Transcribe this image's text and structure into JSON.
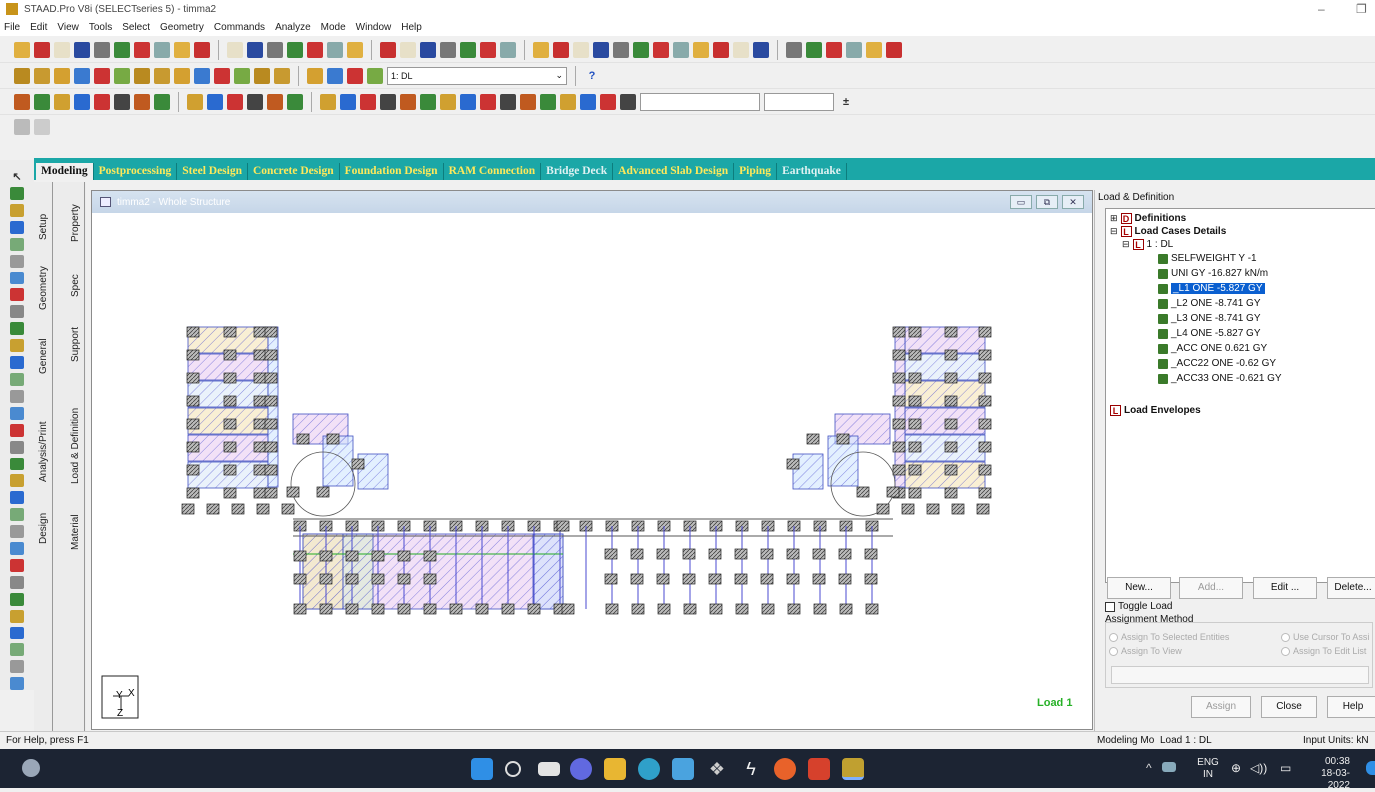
{
  "window": {
    "title": "STAAD.Pro V8i (SELECTseries 5) - timma2",
    "minimize": "–",
    "restore": "❐"
  },
  "menu": [
    "File",
    "Edit",
    "View",
    "Tools",
    "Select",
    "Geometry",
    "Commands",
    "Analyze",
    "Mode",
    "Window",
    "Help"
  ],
  "toolbar": {
    "load_combo": "1: DL",
    "help_icon": "?",
    "pm_icon": "±"
  },
  "ribbon_tabs": [
    {
      "label": "Modeling",
      "state": "active"
    },
    {
      "label": "Postprocessing",
      "state": "normal"
    },
    {
      "label": "Steel Design",
      "state": "normal"
    },
    {
      "label": "Concrete Design",
      "state": "normal"
    },
    {
      "label": "Foundation Design",
      "state": "normal"
    },
    {
      "label": "RAM Connection",
      "state": "normal"
    },
    {
      "label": "Bridge Deck",
      "state": "disabled"
    },
    {
      "label": "Advanced Slab Design",
      "state": "normal"
    },
    {
      "label": "Piping",
      "state": "normal"
    },
    {
      "label": "Earthquake",
      "state": "disabled"
    }
  ],
  "side_tabs_outer": [
    "Setup",
    "Geometry",
    "General",
    "Analysis/Print",
    "Design"
  ],
  "side_tabs_inner": [
    "Property",
    "Spec",
    "Support",
    "Load & Definition",
    "Material"
  ],
  "viewport": {
    "title": "timma2 - Whole Structure",
    "load_label": "Load 1",
    "axis_y": "Y",
    "axis_x": "X",
    "axis_z": "Z"
  },
  "panel": {
    "title": "Load & Definition",
    "tree": {
      "definitions": "Definitions",
      "load_cases_details": "Load Cases Details",
      "case": "1 : DL",
      "items": [
        "SELFWEIGHT Y -1",
        "UNI GY -16.827 kN/m",
        "_L1 ONE -5.827 GY",
        "_L2 ONE -8.741 GY",
        "_L3 ONE -8.741 GY",
        "_L4 ONE -5.827 GY",
        "_ACC ONE 0.621 GY",
        "_ACC22 ONE -0.62 GY",
        "_ACC33 ONE -0.621 GY"
      ],
      "selected_index": 2,
      "load_envelopes": "Load Envelopes"
    },
    "buttons": {
      "new": "New...",
      "add": "Add...",
      "edit": "Edit ...",
      "delete": "Delete..."
    },
    "toggle_load": "Toggle Load",
    "assignment_method": "Assignment Method",
    "radios": [
      "Assign To Selected Entities",
      "Use Cursor To Assi",
      "Assign To View",
      "Assign To Edit List"
    ],
    "bottom_buttons": {
      "assign": "Assign",
      "close": "Close",
      "help": "Help"
    }
  },
  "status": {
    "left": "For Help, press F1",
    "mode": "Modeling Mo",
    "load": "Load 1 : DL",
    "units": "Input Units:  kN"
  },
  "taskbar": {
    "lang": "ENG",
    "region": "IN",
    "time": "00:38",
    "date": "18-03-2022"
  }
}
